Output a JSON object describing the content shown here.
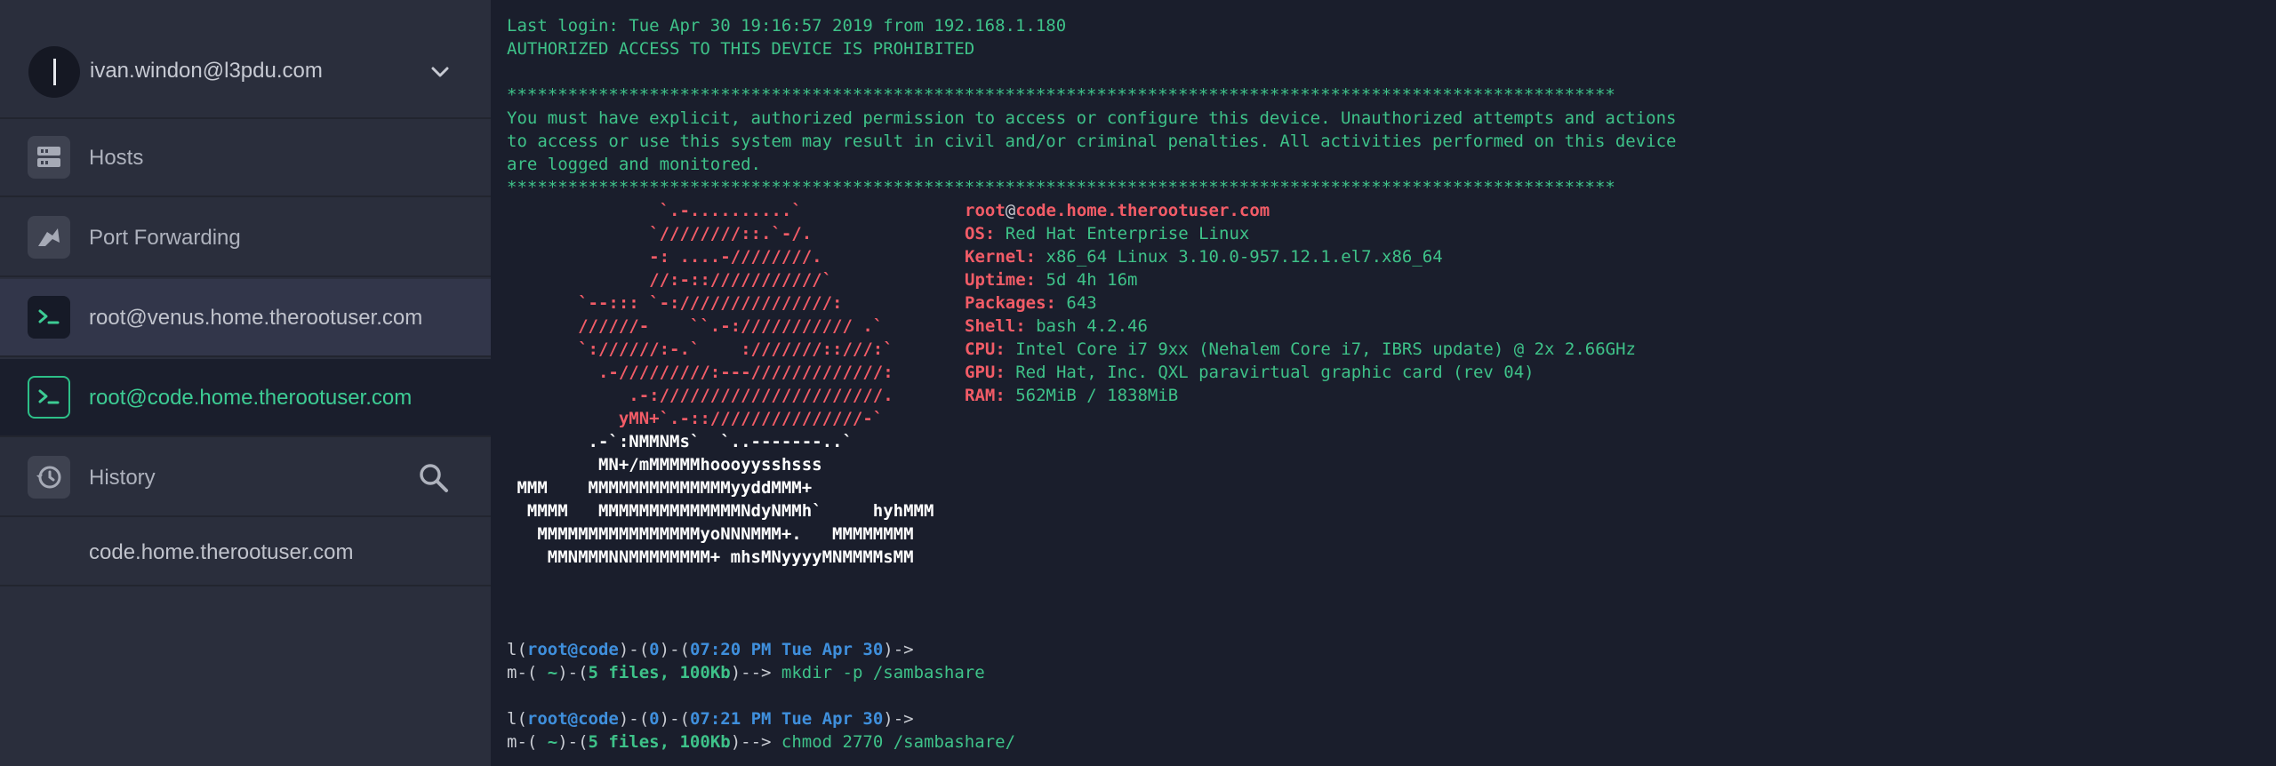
{
  "sidebar": {
    "account": {
      "initial": "I",
      "email": "ivan.windon@l3pdu.com"
    },
    "items": [
      {
        "label": "Hosts",
        "icon": "hosts-icon"
      },
      {
        "label": "Port Forwarding",
        "icon": "port-forwarding-icon"
      },
      {
        "label": "root@venus.home.therootuser.com",
        "icon": "terminal-icon"
      },
      {
        "label": "root@code.home.therootuser.com",
        "icon": "terminal-icon",
        "active": true
      },
      {
        "label": "History",
        "icon": "history-icon"
      },
      {
        "label": "code.home.therootuser.com"
      }
    ]
  },
  "terminal": {
    "login": "Last login: Tue Apr 30 19:16:57 2019 from 192.168.1.180",
    "warning": "AUTHORIZED ACCESS TO THIS DEVICE IS PROHIBITED",
    "stars": "*************************************************************************************************************",
    "notice": [
      "You must have explicit, authorized permission to access or configure this device. Unauthorized attempts and actions",
      "to access or use this system may result in civil and/or criminal penalties. All activities performed on this device",
      "are logged and monitored."
    ],
    "ascii_art": [
      "               `.-..........`",
      "              `////////::.`-/.",
      "              -: ....-////////.",
      "              //:-::///////////`",
      "       `--::: `-:///////////////:",
      "       //////-    ``.-://///////// .`",
      "       `://////:-.`    :///////::///:`",
      "         .-/////////:---/////////////:",
      "            .-://////////////////////.",
      "           yMN+`.-::///////////////-`",
      "        .-`:NMMNMs`  `..-------..`",
      "         MN+/mMMMMMhoooyysshsss",
      " MMM    MMMMMMMMMMMMMMyyddMMM+",
      "  MMMM   MMMMMMMMMMMMMMNdyNMMh`     hyhMMM",
      "   MMMMMMMMMMMMMMMMyoNNNMMM+.   MMMMMMMM",
      "    MMNMMMNNMMMMMMMM+ mhsMNyyyyMNMMMMsMM"
    ],
    "sysinfo": {
      "user": "root",
      "at": "@",
      "host": "code.home.therootuser.com",
      "rows": [
        {
          "key": "OS:",
          "value": "Red Hat Enterprise Linux"
        },
        {
          "key": "Kernel:",
          "value": "x86_64 Linux 3.10.0-957.12.1.el7.x86_64"
        },
        {
          "key": "Uptime:",
          "value": "5d 4h 16m"
        },
        {
          "key": "Packages:",
          "value": "643"
        },
        {
          "key": "Shell:",
          "value": "bash 4.2.46"
        },
        {
          "key": "CPU:",
          "value": "Intel Core i7 9xx (Nehalem Core i7, IBRS update) @ 2x 2.66GHz"
        },
        {
          "key": "GPU:",
          "value": "Red Hat, Inc. QXL paravirtual graphic card (rev 04)"
        },
        {
          "key": "RAM:",
          "value": "562MiB / 1838MiB"
        }
      ]
    },
    "prompts": [
      {
        "userhost": "root@code",
        "code": "0",
        "time": "07:20 PM Tue Apr 30",
        "files": "5 files, 100Kb",
        "command": "mkdir -p /sambashare"
      },
      {
        "userhost": "root@code",
        "code": "0",
        "time": "07:21 PM Tue Apr 30",
        "files": "5 files, 100Kb",
        "command": "chmod 2770 /sambashare/"
      }
    ],
    "prompt_parts": {
      "l_open": "l(",
      "sep1": ")-(",
      "sep2": ")-(",
      "l_close": ")->",
      "m_open": "m-( ",
      "tilde": "~",
      "m_mid": ")-(",
      "m_close": ")--> "
    }
  }
}
